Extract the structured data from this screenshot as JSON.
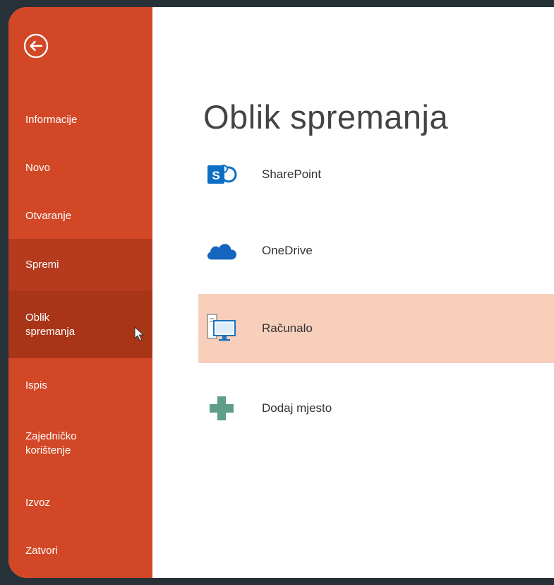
{
  "sidebar": {
    "items": [
      {
        "label": "Informacije"
      },
      {
        "label": "Novo"
      },
      {
        "label": "Otvaranje"
      },
      {
        "label": "Spremi"
      },
      {
        "label": "Oblik\nspremanja"
      },
      {
        "label": "Ispis"
      },
      {
        "label": "Zajedničko\nkorištenje"
      },
      {
        "label": "Izvoz"
      },
      {
        "label": "Zatvori"
      }
    ],
    "active_item": "Oblik\nspremanja"
  },
  "main": {
    "title": "Oblik spremanja",
    "locations": [
      {
        "label": "SharePoint",
        "icon": "sharepoint-icon"
      },
      {
        "label": "OneDrive",
        "icon": "onedrive-cloud-icon"
      },
      {
        "label": "Računalo",
        "icon": "computer-icon",
        "selected": true
      },
      {
        "label": "Dodaj mjesto",
        "icon": "add-place-icon"
      }
    ]
  },
  "colors": {
    "sidebar": "#d24726",
    "sidebar_selected": "#b53a1e",
    "location_selected": "#f8cfbb",
    "background": "#263238"
  }
}
